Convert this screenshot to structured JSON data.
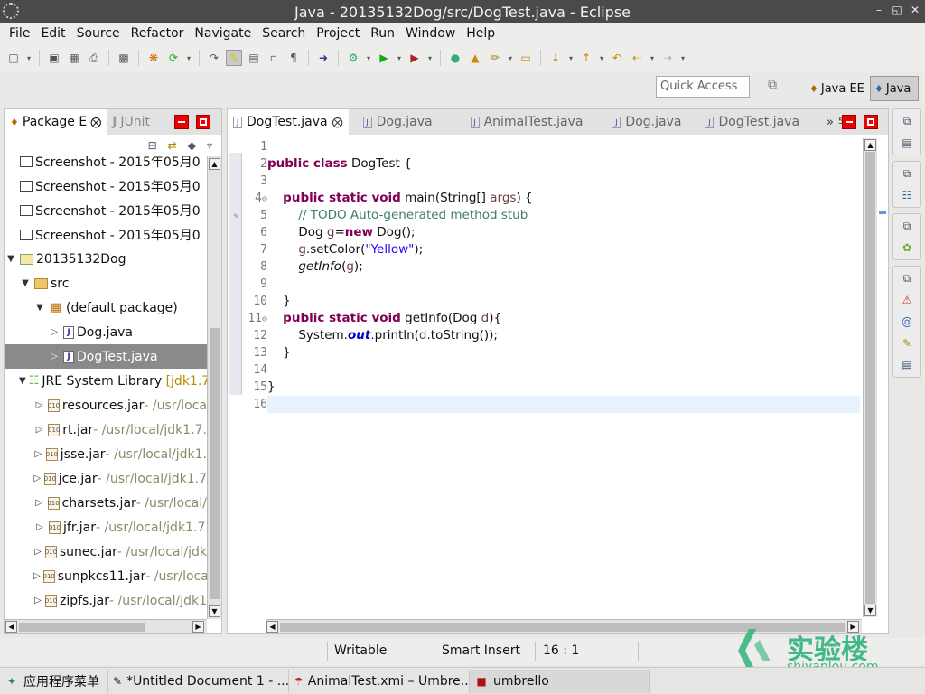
{
  "window": {
    "title": "Java - 20135132Dog/src/DogTest.java - Eclipse",
    "controls": [
      "–",
      "◱",
      "✕"
    ]
  },
  "menu": [
    "File",
    "Edit",
    "Source",
    "Refactor",
    "Navigate",
    "Search",
    "Project",
    "Run",
    "Window",
    "Help"
  ],
  "quick_access": {
    "placeholder": "Quick Access"
  },
  "perspectives": {
    "javaee": "Java EE",
    "java": "Java"
  },
  "package_explorer": {
    "tab_label": "Package E",
    "junit_label": "JUnit",
    "items": [
      {
        "label": "Screenshot - 2015年05月0"
      },
      {
        "label": "Screenshot - 2015年05月0"
      },
      {
        "label": "Screenshot - 2015年05月0"
      },
      {
        "label": "Screenshot - 2015年05月0"
      },
      {
        "label": "20135132Dog"
      },
      {
        "label": "src"
      },
      {
        "label": "(default package)"
      },
      {
        "label": "Dog.java"
      },
      {
        "label": "DogTest.java"
      },
      {
        "label": "JRE System Library",
        "extra": "[jdk1.7."
      },
      {
        "label": "resources.jar",
        "extra": " - /usr/loca"
      },
      {
        "label": "rt.jar",
        "extra": " - /usr/local/jdk1.7."
      },
      {
        "label": "jsse.jar",
        "extra": " - /usr/local/jdk1."
      },
      {
        "label": "jce.jar",
        "extra": " - /usr/local/jdk1.7"
      },
      {
        "label": "charsets.jar",
        "extra": " - /usr/local/"
      },
      {
        "label": "jfr.jar",
        "extra": " - /usr/local/jdk1.7"
      },
      {
        "label": "sunec.jar",
        "extra": " - /usr/local/jdk"
      },
      {
        "label": "sunpkcs11.jar",
        "extra": " - /usr/loca"
      },
      {
        "label": "zipfs.jar",
        "extra": " - /usr/local/jdk1"
      }
    ]
  },
  "editor": {
    "tabs": [
      "DogTest.java",
      "Dog.java",
      "AnimalTest.java",
      "Dog.java",
      "DogTest.java"
    ],
    "overflow": "»",
    "overflow_count": "5",
    "line_numbers": [
      "1",
      "2",
      "3",
      "4",
      "5",
      "6",
      "7",
      "8",
      "9",
      "10",
      "11",
      "12",
      "13",
      "14",
      "15",
      "16"
    ],
    "code": {
      "l2_kw": "public class",
      "l2_rest": " DogTest {",
      "l4_kw": "public static void",
      "l4_rest": " main(String[] ",
      "l4_var": "args",
      "l4_end": ") {",
      "l5_comment": "// TODO Auto-generated method stub",
      "l6_a": "Dog ",
      "l6_var": "g",
      "l6_b": "=",
      "l6_kw": "new",
      "l6_c": " Dog();",
      "l7_var": "g",
      "l7_a": ".setColor(",
      "l7_str": "\"Yellow\"",
      "l7_b": ");",
      "l8_method": "getInfo",
      "l8_a": "(",
      "l8_var": "g",
      "l8_b": ");",
      "l10": "}",
      "l11_kw": "public static void",
      "l11_a": " getInfo(Dog ",
      "l11_var": "d",
      "l11_b": "){",
      "l12_a": "System.",
      "l12_fld": "out",
      "l12_b": ".println(",
      "l12_var": "d",
      "l12_c": ".toString());",
      "l13": "}",
      "l15": "}"
    }
  },
  "status": {
    "writable": "Writable",
    "insert_mode": "Smart Insert",
    "position": "16 : 1"
  },
  "watermark": {
    "cn": "实验楼",
    "en": "shiyanlou.com"
  },
  "taskbar": [
    {
      "label": "应用程序菜单"
    },
    {
      "label": "*Untitled Document 1 - ..."
    },
    {
      "label": "AnimalTest.xmi – Umbre..."
    },
    {
      "label": "umbrello"
    }
  ]
}
